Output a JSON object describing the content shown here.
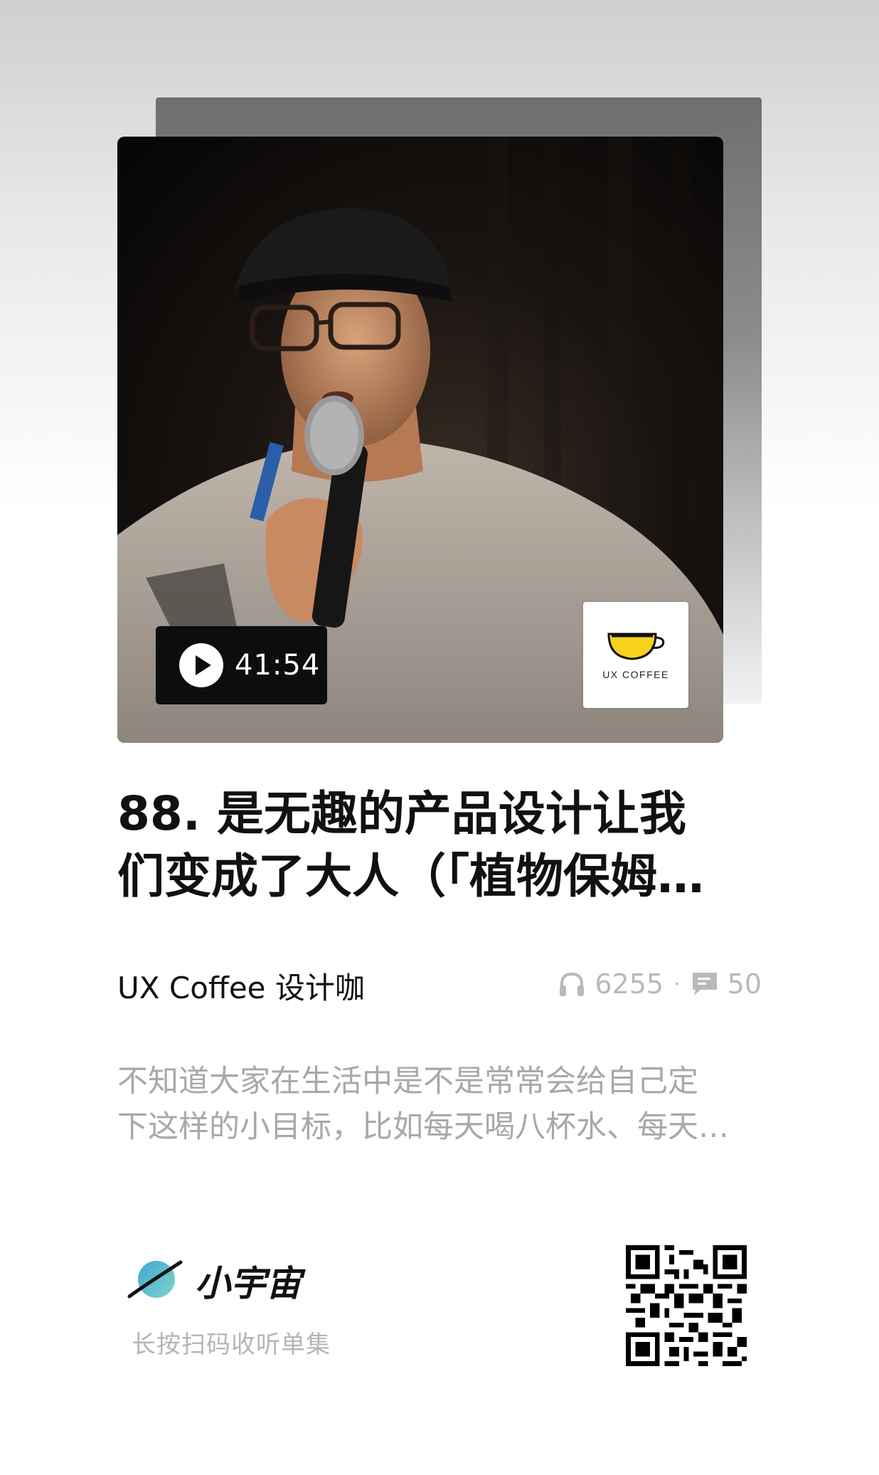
{
  "episode": {
    "duration": "41:54",
    "title_line1": "88. 是无趣的产品设计让我",
    "title_line2": "们变成了大人（「植物保姆…",
    "podcast_name": "UX Coffee 设计咖",
    "plays": "6255",
    "separator": "·",
    "comments": "50",
    "desc_line1": "不知道大家在生活中是不是常常会给自己定",
    "desc_line2": "下这样的小目标，比如每天喝八杯水、每天…"
  },
  "cover": {
    "logo_text": "UX COFFEE",
    "icons": {
      "play": "play-icon",
      "headphones": "headphones-icon",
      "comment": "comment-icon"
    }
  },
  "footer": {
    "brand": "小宇宙",
    "hint": "长按扫码收听单集",
    "qr": "qr-code"
  },
  "colors": {
    "accent_yellow": "#f6d21d",
    "planet_blue": "#3fa8d8",
    "muted_text": "#a8a8a8"
  }
}
